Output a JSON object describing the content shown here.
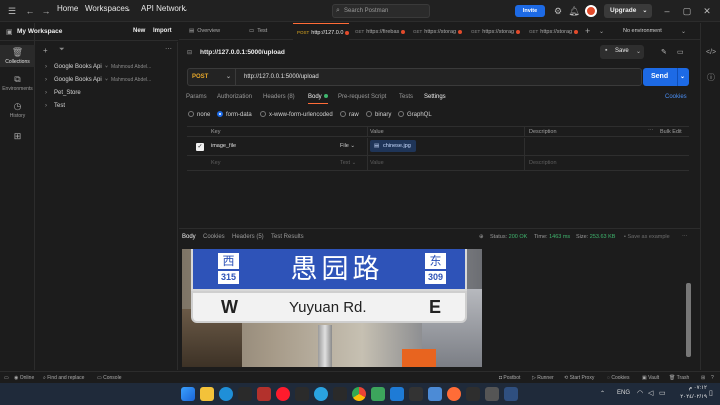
{
  "topbar": {
    "home": "Home",
    "workspaces": "Workspaces",
    "api_network": "API Network",
    "search_placeholder": "Search Postman",
    "invite": "Invite",
    "upgrade": "Upgrade"
  },
  "sidebar": {
    "workspace": "My Workspace",
    "new": "New",
    "import": "Import",
    "items": [
      {
        "label": "Collections",
        "icon": "collections-icon"
      },
      {
        "label": "Environments",
        "icon": "environments-icon"
      },
      {
        "label": "History",
        "icon": "history-icon"
      },
      {
        "label": "",
        "icon": "apps-icon"
      }
    ],
    "collections": [
      {
        "name": "Google Books Api",
        "owner": "Mahmoud Abdel..."
      },
      {
        "name": "Google Books Api",
        "owner": "Mahmoud Abdel..."
      },
      {
        "name": "Pet_Store",
        "owner": ""
      },
      {
        "name": "Test",
        "owner": ""
      }
    ]
  },
  "tabs": [
    {
      "method": "",
      "label": "Overview"
    },
    {
      "method": "",
      "label": "Test"
    },
    {
      "method": "POST",
      "label": "http://127.0.0"
    },
    {
      "method": "GET",
      "label": "https://firebas"
    },
    {
      "method": "GET",
      "label": "https://storag"
    },
    {
      "method": "GET",
      "label": "https://storag"
    },
    {
      "method": "GET",
      "label": "https://storag"
    }
  ],
  "environment": "No environment",
  "request": {
    "title": "http://127.0.0.1:5000/upload",
    "save": "Save",
    "method": "POST",
    "url": "http://127.0.0.1:5000/upload",
    "send": "Send",
    "tabs": [
      "Params",
      "Authorization",
      "Headers (8)",
      "Body",
      "Pre-request Script",
      "Tests",
      "Settings"
    ],
    "cookies": "Cookies",
    "body_types": [
      "none",
      "form-data",
      "x-www-form-urlencoded",
      "raw",
      "binary",
      "GraphQL"
    ],
    "kv_headers": {
      "key": "Key",
      "value": "Value",
      "description": "Description",
      "bulk_edit": "Bulk Edit"
    },
    "rows": [
      {
        "key": "image_file",
        "type": "File",
        "value": "chinese.jpg",
        "description": ""
      }
    ],
    "placeholder_row": {
      "key": "Key",
      "type": "Text",
      "value": "Value",
      "description": "Description"
    }
  },
  "response": {
    "tabs": [
      "Body",
      "Cookies",
      "Headers (5)",
      "Test Results"
    ],
    "status_label": "Status:",
    "status": "200 OK",
    "time_label": "Time:",
    "time": "1463 ms",
    "size_label": "Size:",
    "size": "253.63 KB",
    "save_example": "Save as example",
    "sign": {
      "west": "西",
      "west_num": "315",
      "chinese": "愚园路",
      "east": "东",
      "east_num": "309",
      "w": "W",
      "pinyin": "Yuyuan Rd.",
      "e": "E"
    }
  },
  "footer": {
    "online": "Online",
    "find_replace": "Find and replace",
    "console": "Console",
    "postbot": "Postbot",
    "runner": "Runner",
    "start_proxy": "Start Proxy",
    "cookies": "Cookies",
    "vault": "Vault",
    "trash": "Trash"
  },
  "taskbar": {
    "lang": "ENG",
    "time": "٠٧:١٢ م",
    "date": "٢٠٢٤/٠٢/١٩"
  },
  "colors": {
    "accent": "#1d6ae5",
    "brand": "#ff6c37",
    "status_ok": "#3fb66e"
  }
}
